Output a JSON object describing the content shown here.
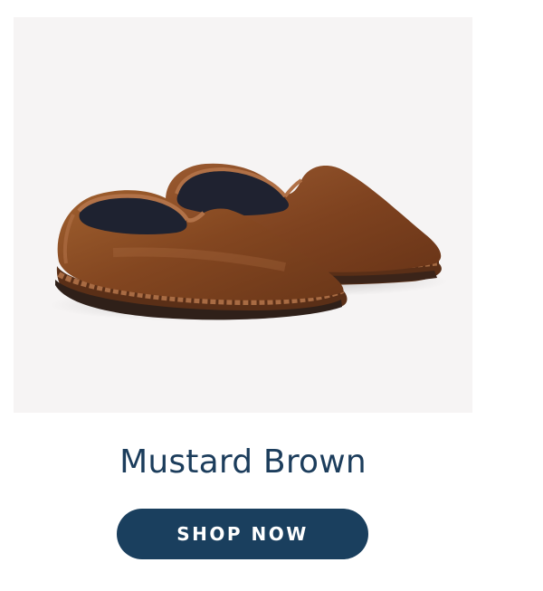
{
  "product": {
    "name": "Mustard Brown",
    "image_alt": "brown velvet slipper pair",
    "image_background": "#f6f4f4",
    "slipper_color": "#8a4b25",
    "cta_label": "SHOP NOW",
    "cta_color": "#1a3f5e",
    "name_color": "#1c3d5c"
  }
}
